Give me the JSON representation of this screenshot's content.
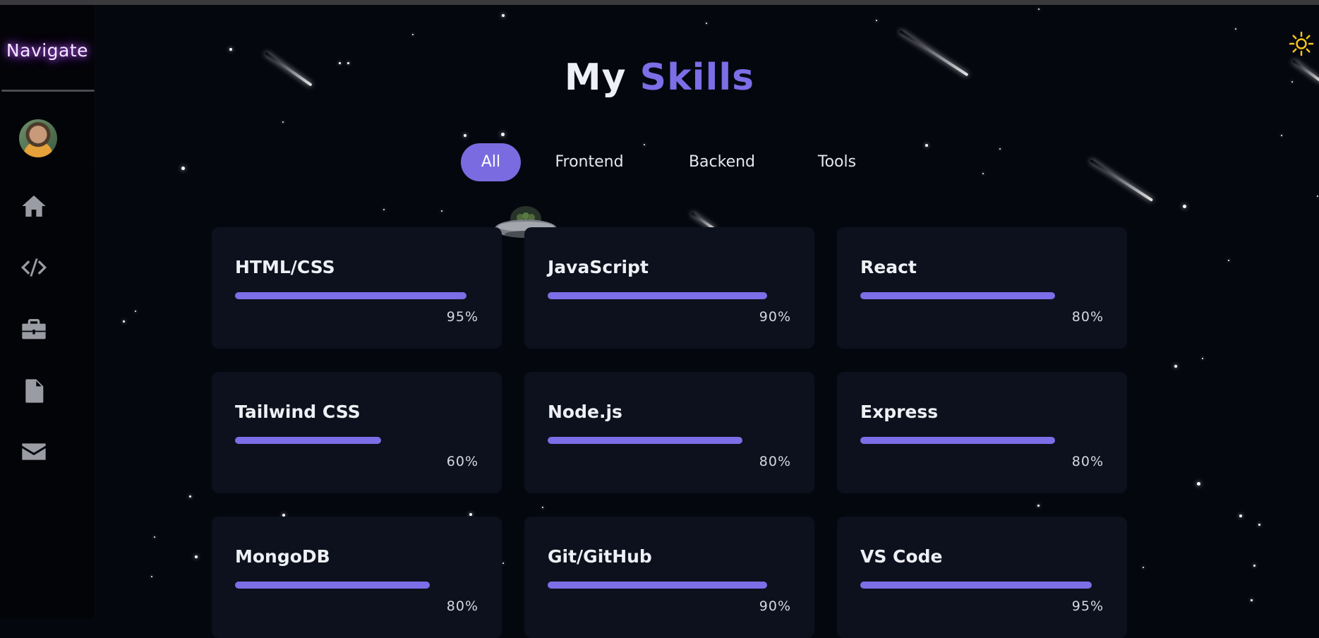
{
  "sidebar": {
    "title": "Navigate",
    "items": [
      {
        "name": "home",
        "icon": "home-icon"
      },
      {
        "name": "skills",
        "icon": "code-icon"
      },
      {
        "name": "projects",
        "icon": "briefcase-icon"
      },
      {
        "name": "resume",
        "icon": "document-icon"
      },
      {
        "name": "contact",
        "icon": "envelope-icon"
      }
    ]
  },
  "header": {
    "title_part1": "My",
    "title_part2": "Skills"
  },
  "tabs": [
    {
      "label": "All",
      "active": true
    },
    {
      "label": "Frontend",
      "active": false
    },
    {
      "label": "Backend",
      "active": false
    },
    {
      "label": "Tools",
      "active": false
    }
  ],
  "skills": [
    {
      "name": "HTML/CSS",
      "percent_label": "95%",
      "level": 95
    },
    {
      "name": "JavaScript",
      "percent_label": "90%",
      "level": 90
    },
    {
      "name": "React",
      "percent_label": "80%",
      "level": 80
    },
    {
      "name": "Tailwind CSS",
      "percent_label": "60%",
      "level": 60
    },
    {
      "name": "Node.js",
      "percent_label": "80%",
      "level": 80
    },
    {
      "name": "Express",
      "percent_label": "80%",
      "level": 80
    },
    {
      "name": "MongoDB",
      "percent_label": "80%",
      "level": 80
    },
    {
      "name": "Git/GitHub",
      "percent_label": "90%",
      "level": 90
    },
    {
      "name": "VS Code",
      "percent_label": "95%",
      "level": 95
    }
  ],
  "colors": {
    "accent": "#7b6ee6",
    "background": "#05070f",
    "card": "#0d111d",
    "sun": "#f5c518"
  },
  "theme_toggle_icon": "sun-icon"
}
